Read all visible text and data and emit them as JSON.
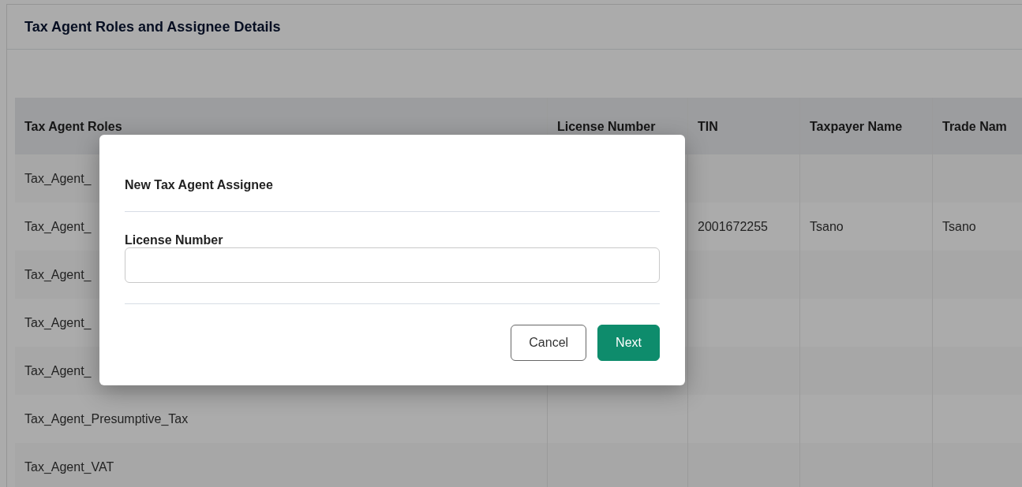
{
  "page": {
    "title": "Tax Agent Roles and Assignee Details"
  },
  "table": {
    "columns": [
      "Tax Agent Roles",
      "License Number",
      "TIN",
      "Taxpayer Name",
      "Trade Nam"
    ],
    "rows": [
      {
        "cells": [
          "Tax_Agent_",
          null,
          null,
          null,
          null
        ]
      },
      {
        "cells": [
          "Tax_Agent_",
          null,
          "2001672255",
          "Tsano",
          "Tsano"
        ]
      },
      {
        "cells": [
          "Tax_Agent_",
          null,
          null,
          null,
          null
        ]
      },
      {
        "cells": [
          "Tax_Agent_",
          null,
          null,
          null,
          null
        ]
      },
      {
        "cells": [
          "Tax_Agent_",
          null,
          null,
          null,
          null
        ]
      },
      {
        "cells": [
          "Tax_Agent_Presumptive_Tax",
          null,
          null,
          null,
          null
        ]
      },
      {
        "cells": [
          "Tax_Agent_VAT",
          null,
          null,
          null,
          null
        ]
      }
    ]
  },
  "dialog": {
    "title": "New Tax Agent Assignee",
    "field": {
      "label": "License Number"
    },
    "buttons": [
      {
        "label": "Cancel",
        "kind": "secondary"
      },
      {
        "label": "Next",
        "kind": "primary"
      }
    ]
  }
}
